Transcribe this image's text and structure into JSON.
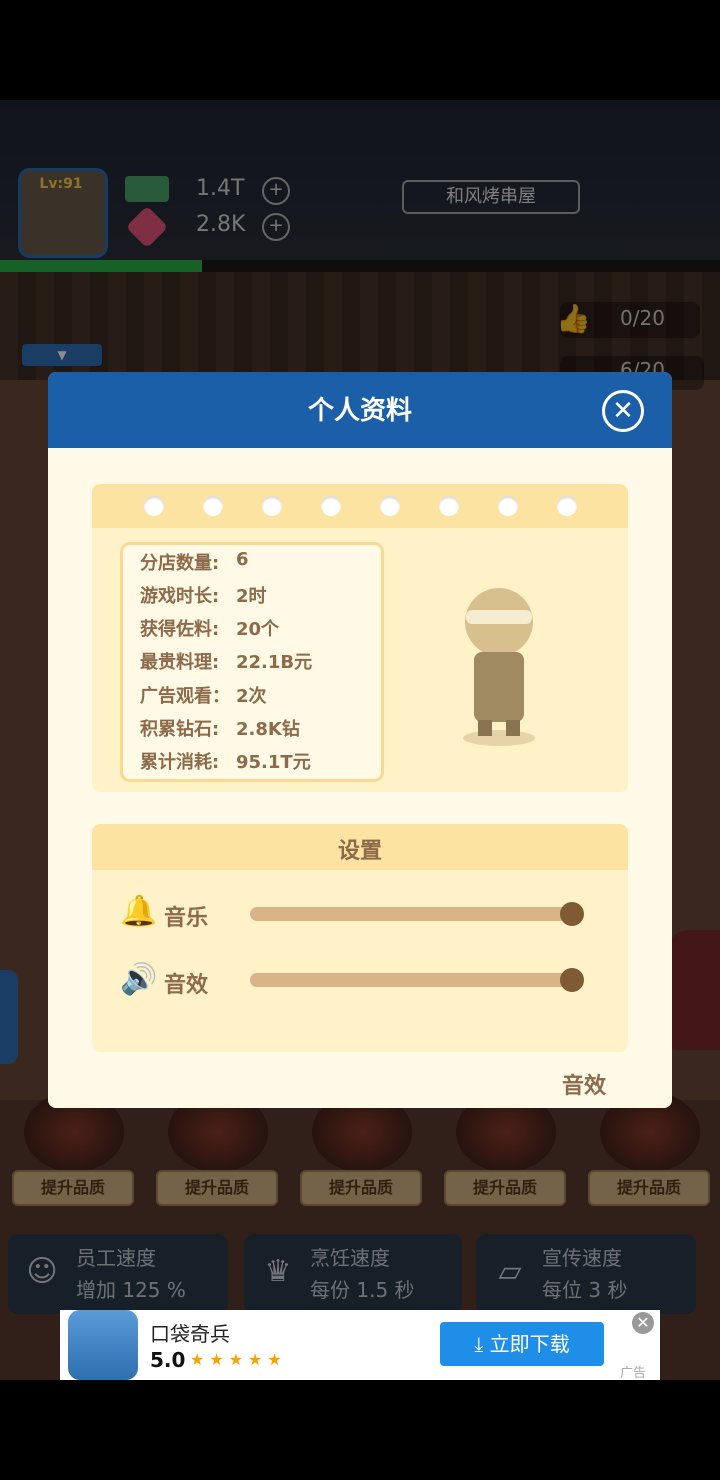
{
  "hud": {
    "level": "Lv:91",
    "cash": "1.4T",
    "gems": "2.8K",
    "plus": "+",
    "shop_name": "和风烤串屋",
    "likes": "0/20",
    "stars": "6/20",
    "level_progress": 0.28
  },
  "dishes": {
    "upgrade_label": "提升品质"
  },
  "stats_cards": [
    {
      "title": "员工速度",
      "value": "增加 125 %"
    },
    {
      "title": "烹饪速度",
      "value": "每份 1.5 秒"
    },
    {
      "title": "宣传速度",
      "value": "每位 3 秒"
    }
  ],
  "ad": {
    "title": "口袋奇兵",
    "rating": "5.0",
    "stars": "★★★★★",
    "download": "⤓ 立即下载",
    "close": "✕",
    "label": "广告"
  },
  "modal": {
    "title": "个人资料",
    "close": "✕",
    "stats": [
      {
        "label": "分店数量:",
        "value": "6"
      },
      {
        "label": "游戏时长:",
        "value": "2时"
      },
      {
        "label": "获得佐料:",
        "value": "20个"
      },
      {
        "label": "最贵料理:",
        "value": "22.1B元"
      },
      {
        "label": "广告观看：",
        "value": "2次"
      },
      {
        "label": "积累钻石:",
        "value": "2.8K钻"
      },
      {
        "label": "累计消耗:",
        "value": "95.1T元"
      }
    ],
    "settings": {
      "title": "设置",
      "music_label": "音乐",
      "music_level": 1.0,
      "sfx_label": "音效",
      "sfx_level": 1.0
    },
    "footer_label": "音效"
  }
}
